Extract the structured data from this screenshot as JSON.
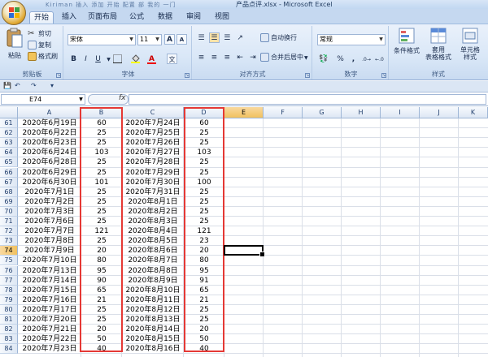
{
  "window": {
    "title": "产品点评.xlsx - Microsoft Excel",
    "faded_title": "Kiriman 插入 添加 开始 配置 部 我的 一门"
  },
  "tabs": [
    "开始",
    "插入",
    "页面布局",
    "公式",
    "数据",
    "审阅",
    "视图"
  ],
  "ribbon": {
    "clipboard": {
      "paste": "粘贴",
      "cut": "剪切",
      "copy": "复制",
      "format_painter": "格式刷",
      "label": "剪贴板"
    },
    "font": {
      "name": "宋体",
      "size": "11",
      "grow": "A",
      "shrink": "A",
      "bold": "B",
      "italic": "I",
      "underline": "U",
      "wen": "文",
      "label": "字体"
    },
    "alignment": {
      "wrap": "自动换行",
      "merge": "合并后居中",
      "label": "对齐方式"
    },
    "number": {
      "format": "常规",
      "percent": "%",
      "comma": ",",
      "label": "数字"
    },
    "styles": {
      "conditional": "条件格式",
      "table": "套用表格格式",
      "table_line1": "套用",
      "table_line2": "表格格式",
      "cell": "单元格样式",
      "cell_line1": "单元格",
      "cell_line2": "样式",
      "label": "样式"
    }
  },
  "formula_bar": {
    "name_box": "E74",
    "fx": "fx",
    "value": ""
  },
  "columns": [
    "A",
    "B",
    "C",
    "D",
    "E",
    "F",
    "G",
    "H",
    "I",
    "J",
    "K"
  ],
  "selected_cell": {
    "column": "E",
    "row": "74"
  },
  "rows": [
    {
      "n": "61",
      "a": "2020年6月19日",
      "b": "60",
      "c": "2020年7月24日",
      "d": "60"
    },
    {
      "n": "62",
      "a": "2020年6月22日",
      "b": "25",
      "c": "2020年7月25日",
      "d": "25"
    },
    {
      "n": "63",
      "a": "2020年6月23日",
      "b": "25",
      "c": "2020年7月26日",
      "d": "25"
    },
    {
      "n": "64",
      "a": "2020年6月24日",
      "b": "103",
      "c": "2020年7月27日",
      "d": "103"
    },
    {
      "n": "65",
      "a": "2020年6月28日",
      "b": "25",
      "c": "2020年7月28日",
      "d": "25"
    },
    {
      "n": "66",
      "a": "2020年6月29日",
      "b": "25",
      "c": "2020年7月29日",
      "d": "25"
    },
    {
      "n": "67",
      "a": "2020年6月30日",
      "b": "101",
      "c": "2020年7月30日",
      "d": "100"
    },
    {
      "n": "68",
      "a": "2020年7月1日",
      "b": "25",
      "c": "2020年7月31日",
      "d": "25"
    },
    {
      "n": "69",
      "a": "2020年7月2日",
      "b": "25",
      "c": "2020年8月1日",
      "d": "25"
    },
    {
      "n": "70",
      "a": "2020年7月3日",
      "b": "25",
      "c": "2020年8月2日",
      "d": "25"
    },
    {
      "n": "71",
      "a": "2020年7月6日",
      "b": "25",
      "c": "2020年8月3日",
      "d": "25"
    },
    {
      "n": "72",
      "a": "2020年7月7日",
      "b": "121",
      "c": "2020年8月4日",
      "d": "121"
    },
    {
      "n": "73",
      "a": "2020年7月8日",
      "b": "25",
      "c": "2020年8月5日",
      "d": "23"
    },
    {
      "n": "74",
      "a": "2020年7月9日",
      "b": "20",
      "c": "2020年8月6日",
      "d": "20"
    },
    {
      "n": "75",
      "a": "2020年7月10日",
      "b": "80",
      "c": "2020年8月7日",
      "d": "80"
    },
    {
      "n": "76",
      "a": "2020年7月13日",
      "b": "95",
      "c": "2020年8月8日",
      "d": "95"
    },
    {
      "n": "77",
      "a": "2020年7月14日",
      "b": "90",
      "c": "2020年8月9日",
      "d": "91"
    },
    {
      "n": "78",
      "a": "2020年7月15日",
      "b": "65",
      "c": "2020年8月10日",
      "d": "65"
    },
    {
      "n": "79",
      "a": "2020年7月16日",
      "b": "21",
      "c": "2020年8月11日",
      "d": "21"
    },
    {
      "n": "80",
      "a": "2020年7月17日",
      "b": "25",
      "c": "2020年8月12日",
      "d": "25"
    },
    {
      "n": "81",
      "a": "2020年7月20日",
      "b": "25",
      "c": "2020年8月13日",
      "d": "25"
    },
    {
      "n": "82",
      "a": "2020年7月21日",
      "b": "20",
      "c": "2020年8月14日",
      "d": "20"
    },
    {
      "n": "83",
      "a": "2020年7月22日",
      "b": "50",
      "c": "2020年8月15日",
      "d": "50"
    },
    {
      "n": "84",
      "a": "2020年7月23日",
      "b": "40",
      "c": "2020年8月16日",
      "d": "40"
    }
  ],
  "colors": {
    "highlight_box": "#e53935",
    "selected_header": "#f1c15f"
  }
}
